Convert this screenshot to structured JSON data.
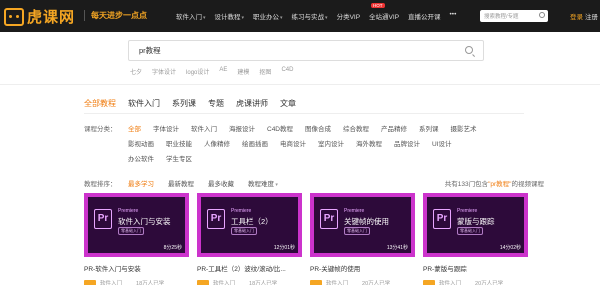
{
  "header": {
    "logo_text": "虎课网",
    "slogan": "每天进步一点点",
    "nav": [
      {
        "label": "软件入门",
        "caret": true
      },
      {
        "label": "设计教程",
        "caret": true
      },
      {
        "label": "职业办公",
        "caret": true
      },
      {
        "label": "练习与实战",
        "caret": true
      },
      {
        "label": "分类VIP",
        "caret": false
      },
      {
        "label": "全站通VIP",
        "caret": false
      },
      {
        "label": "直播公开课",
        "caret": false
      },
      {
        "label": "•••",
        "caret": false
      }
    ],
    "hot_badge": "HOT",
    "search_placeholder": "搜索教程/专题",
    "login": "登录",
    "register": "注册"
  },
  "search": {
    "value": "pr教程",
    "hotwords": [
      "七夕",
      "字体设计",
      "logo设计",
      "AE",
      "建模",
      "抠图",
      "C4D"
    ]
  },
  "tabs": [
    "全部教程",
    "软件入门",
    "系列课",
    "专题",
    "虎课讲师",
    "文章"
  ],
  "active_tab": 0,
  "categories": {
    "label": "课程分类：",
    "rows": [
      [
        "全部",
        "字体设计",
        "软件入门",
        "海报设计",
        "C4D教程",
        "图像合成",
        "综合教程",
        "产品精修",
        "系列课",
        "摄影艺术"
      ],
      [
        "影视动画",
        "职业技能",
        "人像精修",
        "绘画插画",
        "电商设计",
        "室内设计",
        "海外教程",
        "品牌设计",
        "UI设计"
      ],
      [
        "办公软件",
        "学生专区"
      ]
    ],
    "active": "全部"
  },
  "sort": {
    "label": "教程排序：",
    "options": [
      "最多学习",
      "最新教程",
      "最多收藏",
      "教程难度"
    ],
    "active": "最多学习",
    "result_prefix": "共有133门包含",
    "result_keyword": "\"pr教程\"",
    "result_suffix": "的视频课程"
  },
  "cards": [
    {
      "premiere": "Premiere",
      "thumb_title": "软件入门与安装",
      "thumb_sub": "零基础入门",
      "duration": "8分25秒",
      "title": "PR-软件入门与安装",
      "level": "软件入门",
      "count": "18万人已学"
    },
    {
      "premiere": "Premiere",
      "thumb_title": "工具栏（2）",
      "thumb_sub": "零基础入门",
      "duration": "12分01秒",
      "title": "PR-工具栏（2）波纹/滚动/比...",
      "level": "软件入门",
      "count": "18万人已学"
    },
    {
      "premiere": "Premiere",
      "thumb_title": "关键帧的使用",
      "thumb_sub": "零基础入门",
      "duration": "13分41秒",
      "title": "PR-关键帧的使用",
      "level": "软件入门",
      "count": "20万人已学"
    },
    {
      "premiere": "Premiere",
      "thumb_title": "蒙版与跟踪",
      "thumb_sub": "零基础入门",
      "duration": "14分02秒",
      "title": "PR-蒙版与跟踪",
      "level": "软件入门",
      "count": "20万人已学"
    }
  ],
  "colors": {
    "accent": "#f07c0f",
    "nav_bg": "#1b1b1b",
    "logo": "#f5a623",
    "thumb_border": "#cc33cc",
    "thumb_bg": "#2d0a3a"
  }
}
